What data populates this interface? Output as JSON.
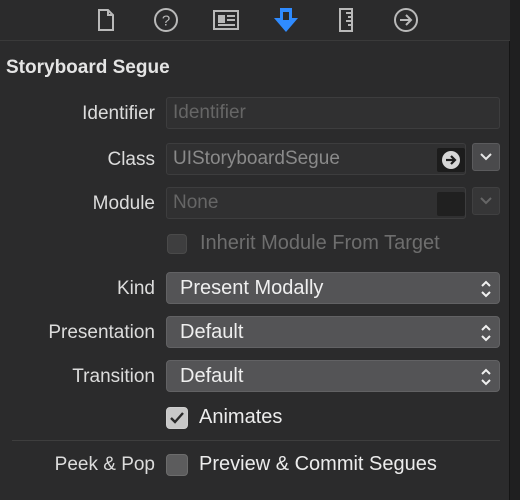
{
  "toolbar": {
    "icons": [
      "file-inspector-icon",
      "quick-help-icon",
      "identity-inspector-icon",
      "attributes-inspector-icon",
      "size-inspector-icon",
      "connections-inspector-icon"
    ],
    "active_icon": "attributes-inspector-icon",
    "active_color": "#2f8bff"
  },
  "section": {
    "title": "Storyboard Segue"
  },
  "identifier": {
    "label": "Identifier",
    "placeholder": "Identifier",
    "value": ""
  },
  "class": {
    "label": "Class",
    "value": "UIStoryboardSegue"
  },
  "module": {
    "label": "Module",
    "value": "None"
  },
  "inherit": {
    "label": "Inherit Module From Target",
    "checked": false,
    "enabled": false
  },
  "kind": {
    "label": "Kind",
    "value": "Present Modally"
  },
  "presentation": {
    "label": "Presentation",
    "value": "Default"
  },
  "transition": {
    "label": "Transition",
    "value": "Default"
  },
  "animates": {
    "label": "Animates",
    "checked": true
  },
  "peek_pop": {
    "label": "Peek & Pop",
    "checkbox_label": "Preview & Commit Segues",
    "checked": false
  }
}
